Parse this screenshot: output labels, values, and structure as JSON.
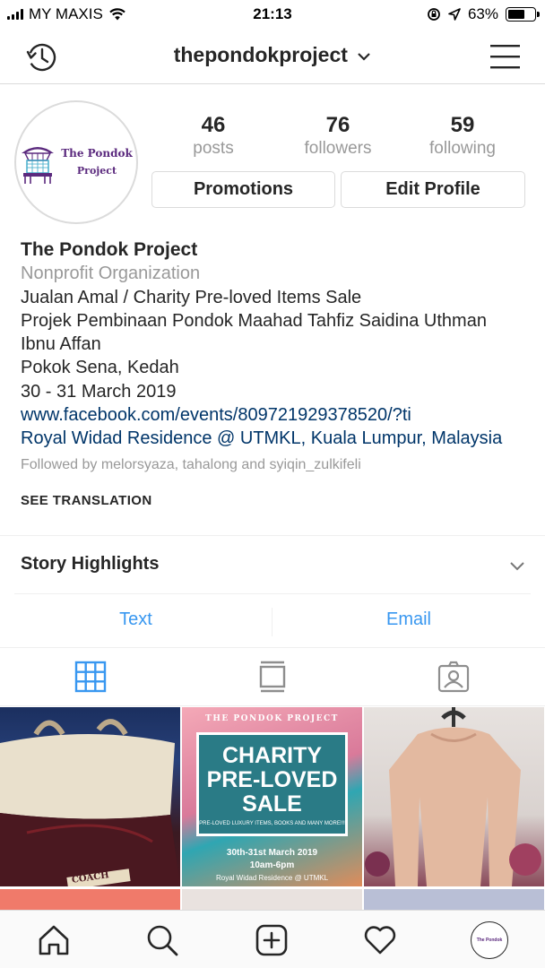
{
  "status_bar": {
    "carrier": "MY MAXIS",
    "time": "21:13",
    "battery_percent": "63%",
    "battery_level": 0.63
  },
  "header": {
    "username": "thepondokproject",
    "username_dropdown_icon": "chevron-down-icon",
    "left_icon": "history-icon",
    "right_icon": "hamburger-menu-icon"
  },
  "profile": {
    "avatar_logo_line1": "The Pondok",
    "avatar_logo_line2": "Project",
    "stats": [
      {
        "value": "46",
        "label": "posts"
      },
      {
        "value": "76",
        "label": "followers"
      },
      {
        "value": "59",
        "label": "following"
      }
    ],
    "buttons": {
      "promotions": "Promotions",
      "edit_profile": "Edit Profile"
    }
  },
  "bio": {
    "name": "The Pondok Project",
    "category": "Nonprofit Organization",
    "lines": [
      "Jualan Amal / Charity Pre-loved Items Sale",
      "Projek Pembinaan Pondok Maahad Tahfiz Saidina Uthman",
      "Ibnu Affan",
      "Pokok Sena, Kedah",
      "30 - 31 March 2019"
    ],
    "website": "www.facebook.com/events/809721929378520/?ti",
    "location": "Royal Widad Residence @ UTMKL, Kuala Lumpur, Malaysia",
    "followed_by": "Followed by melorsyaza, tahalong and syiqin_zulkifeli",
    "see_translation": "SEE TRANSLATION"
  },
  "story_highlights": {
    "label": "Story Highlights"
  },
  "contact": {
    "text": "Text",
    "email": "Email"
  },
  "tabs": [
    "grid-icon",
    "feed-icon",
    "tagged-icon"
  ],
  "posts": [
    {
      "name": "bag-photo",
      "label": "COACH"
    },
    {
      "name": "charity-poster",
      "org": "THE PONDOK PROJECT",
      "headline1": "CHARITY",
      "headline2": "PRE-LOVED",
      "headline3": "SALE",
      "fine_print": "PRE-LOVED LUXURY ITEMS, BOOKS AND MANY MORE!!!",
      "date": "30th-31st March 2019",
      "hours": "10am-6pm",
      "venue": "Royal Widad Residence @ UTMKL"
    },
    {
      "name": "blouse-photo"
    }
  ],
  "bottom_nav": [
    "home-icon",
    "search-icon",
    "new-post-icon",
    "activity-heart-icon",
    "profile-avatar"
  ],
  "colors": {
    "link_blue": "#3897f0",
    "dark_link": "#003569",
    "muted": "#999999",
    "border": "#dbdbdb",
    "logo_purple": "#5b2a7e"
  }
}
